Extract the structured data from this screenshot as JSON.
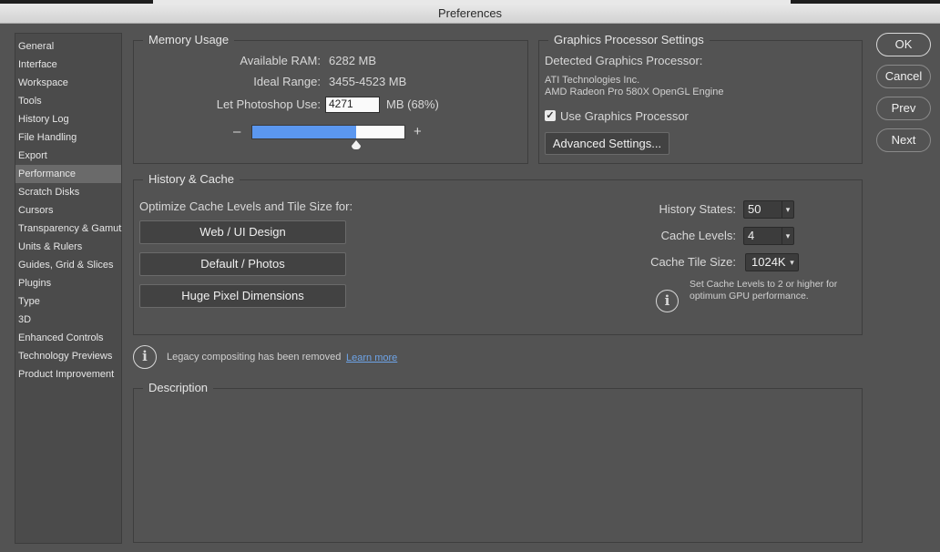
{
  "window": {
    "title": "Preferences"
  },
  "sidebar": {
    "items": [
      "General",
      "Interface",
      "Workspace",
      "Tools",
      "History Log",
      "File Handling",
      "Export",
      "Performance",
      "Scratch Disks",
      "Cursors",
      "Transparency & Gamut",
      "Units & Rulers",
      "Guides, Grid & Slices",
      "Plugins",
      "Type",
      "3D",
      "Enhanced Controls",
      "Technology Previews",
      "Product Improvement"
    ],
    "selected": "Performance"
  },
  "memory": {
    "title": "Memory Usage",
    "available_label": "Available RAM:",
    "available_value": "6282 MB",
    "ideal_label": "Ideal Range:",
    "ideal_value": "3455-4523 MB",
    "use_label": "Let Photoshop Use:",
    "use_value": "4271",
    "use_suffix": "MB (68%)",
    "minus": "–",
    "plus": "+",
    "slider_fraction": 0.68
  },
  "gpu": {
    "title": "Graphics Processor Settings",
    "detected_label": "Detected Graphics Processor:",
    "vendor": "ATI Technologies Inc.",
    "model": "AMD Radeon Pro 580X OpenGL Engine",
    "use_label": "Use Graphics Processor",
    "use_checked": true,
    "advanced_button": "Advanced Settings..."
  },
  "history_cache": {
    "title": "History & Cache",
    "optimize_label": "Optimize Cache Levels and Tile Size for:",
    "buttons": [
      "Web / UI Design",
      "Default / Photos",
      "Huge Pixel Dimensions"
    ],
    "history_states_label": "History States:",
    "history_states_value": "50",
    "cache_levels_label": "Cache Levels:",
    "cache_levels_value": "4",
    "tile_size_label": "Cache Tile Size:",
    "tile_size_value": "1024K",
    "hint_line1": "Set Cache Levels to 2 or higher for",
    "hint_line2": "optimum GPU performance."
  },
  "legacy": {
    "text": "Legacy compositing has been removed",
    "link": "Learn more"
  },
  "description": {
    "title": "Description"
  },
  "actions": {
    "ok": "OK",
    "cancel": "Cancel",
    "prev": "Prev",
    "next": "Next"
  },
  "icons": {
    "caret": "▾",
    "check": "✓",
    "info": "i"
  }
}
